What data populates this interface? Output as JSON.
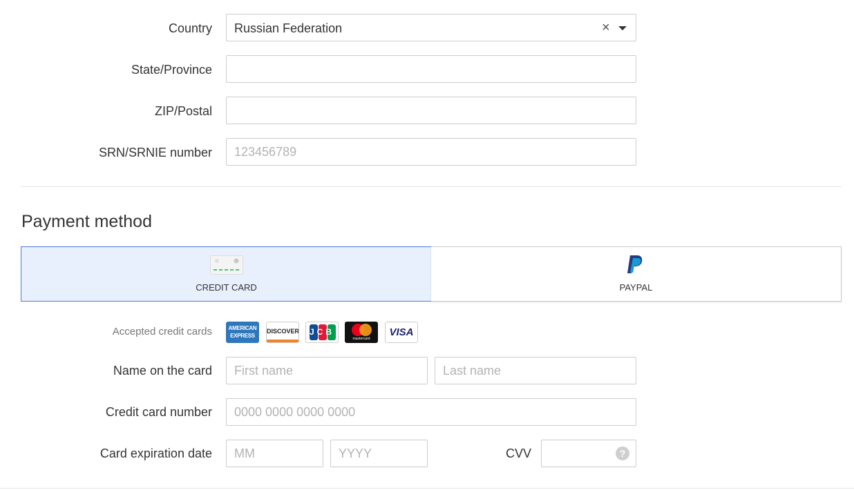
{
  "address": {
    "country_label": "Country",
    "country_value": "Russian Federation",
    "country_clear": "×",
    "state_label": "State/Province",
    "state_value": "",
    "zip_label": "ZIP/Postal",
    "zip_value": "",
    "srn_label": "SRN/SRNIE number",
    "srn_placeholder": "123456789"
  },
  "payment": {
    "title": "Payment method",
    "methods": [
      {
        "label": "CREDIT CARD",
        "icon": "credit-card-icon",
        "selected": true
      },
      {
        "label": "PAYPAL",
        "icon": "paypal-icon",
        "selected": false
      }
    ],
    "accepted_label": "Accepted credit cards",
    "accepted_cards": [
      {
        "name": "american-express-logo",
        "text_line1": "AMERICAN",
        "text_line2": "EXPRESS",
        "color": "#2e77bc"
      },
      {
        "name": "discover-logo",
        "text": "DISCOVER",
        "color": "#f58220"
      },
      {
        "name": "jcb-logo",
        "text": "JCB",
        "colors": [
          "#0e4c96",
          "#e21836",
          "#009f50"
        ]
      },
      {
        "name": "mastercard-logo",
        "text": "mastercard",
        "colors": [
          "#eb001b",
          "#f79e1b"
        ]
      },
      {
        "name": "visa-logo",
        "text": "VISA",
        "color": "#1a1f71"
      }
    ],
    "name_label": "Name on the card",
    "first_name_placeholder": "First name",
    "last_name_placeholder": "Last name",
    "card_number_label": "Credit card number",
    "card_number_placeholder": "0000 0000 0000 0000",
    "expiration_label": "Card expiration date",
    "month_placeholder": "MM",
    "year_placeholder": "YYYY",
    "cvv_label": "CVV",
    "cvv_help": "?"
  },
  "colors": {
    "accent": "#4a7cdb",
    "selected_tab_bg": "#e8effd",
    "border": "#cccccc"
  }
}
